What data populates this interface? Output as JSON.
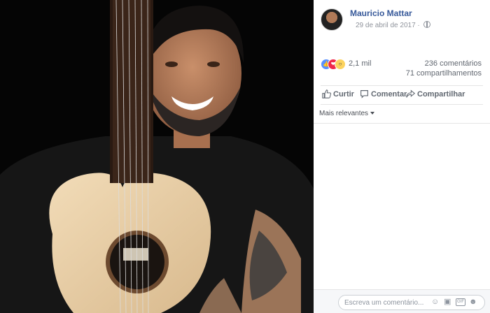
{
  "post": {
    "author": "Mauricio Mattar",
    "date": "29 de abril de 2017",
    "privacy_icon": "globe-icon"
  },
  "reactions": {
    "icons": [
      "like-icon",
      "love-icon",
      "wow-icon"
    ],
    "count": "2,1 mil"
  },
  "stats": {
    "comments": "236 comentários",
    "shares": "71 compartilhamentos"
  },
  "actions": {
    "like_label": "Curtir",
    "comment_label": "Comentar",
    "share_label": "Compartilhar"
  },
  "comments": {
    "sort_label": "Mais relevantes",
    "input_placeholder": "Escreva um comentário...",
    "composer_icons": [
      "emoji-icon",
      "camera-icon",
      "gif-icon",
      "sticker-icon"
    ]
  },
  "colors": {
    "link_blue": "#365899",
    "like_blue": "#5890ff",
    "love_red": "#f0284a",
    "wow_yellow": "#fcd35e",
    "photo_background": "#050505"
  }
}
